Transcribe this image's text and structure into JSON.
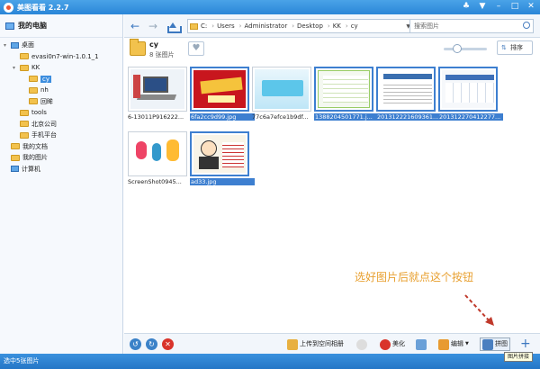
{
  "app": {
    "title": "美图看看 2.2.7"
  },
  "sidebar": {
    "root": "我的电脑",
    "nodes": [
      {
        "label": "桌面",
        "indent": 0,
        "type": "desktop",
        "expander": "▾"
      },
      {
        "label": "evasi0n7-win-1.0.1_1",
        "indent": 1,
        "type": "folder",
        "expander": ""
      },
      {
        "label": "KK",
        "indent": 1,
        "type": "folder",
        "expander": "▾"
      },
      {
        "label": "cy",
        "indent": 2,
        "type": "folder",
        "expander": "",
        "selected": true
      },
      {
        "label": "nh",
        "indent": 2,
        "type": "folder",
        "expander": ""
      },
      {
        "label": "回眸",
        "indent": 2,
        "type": "folder",
        "expander": ""
      },
      {
        "label": "tools",
        "indent": 1,
        "type": "folder",
        "expander": ""
      },
      {
        "label": "北京公司",
        "indent": 1,
        "type": "folder",
        "expander": ""
      },
      {
        "label": "手机平台",
        "indent": 1,
        "type": "folder",
        "expander": ""
      },
      {
        "label": "我的文档",
        "indent": 0,
        "type": "folder",
        "expander": ""
      },
      {
        "label": "我的图片",
        "indent": 0,
        "type": "folder",
        "expander": ""
      },
      {
        "label": "计算机",
        "indent": 0,
        "type": "desktop",
        "expander": ""
      }
    ]
  },
  "toolbar": {
    "back": "←",
    "forward": "→",
    "path": [
      "C:",
      "Users",
      "Administrator",
      "Desktop",
      "KK",
      "cy"
    ],
    "search_placeholder": "搜索图片"
  },
  "info": {
    "folder_name": "cy",
    "count": "8 张图片",
    "sort_label": "排序"
  },
  "thumbnails": [
    {
      "caption": "6-13011P916222...",
      "selected": false,
      "art": "laptop"
    },
    {
      "caption": "6fa2cc9d99.jpg",
      "selected": true,
      "art": "red"
    },
    {
      "caption": "77c6a7efce1b9df...",
      "selected": false,
      "art": "blue"
    },
    {
      "caption": "1388204501771.j...",
      "selected": true,
      "art": "table"
    },
    {
      "caption": "201312221609361...",
      "selected": true,
      "art": "doc"
    },
    {
      "caption": "201312270412277...",
      "selected": true,
      "art": "form"
    },
    {
      "caption": "ScreenShot0945...",
      "selected": false,
      "art": "cartoon"
    },
    {
      "caption": "ad33.jpg",
      "selected": true,
      "art": "person"
    }
  ],
  "bottombar": {
    "upload_label": "上传到空间相册",
    "beautify_label": "美化",
    "edit_label": "编辑",
    "puzzle_label": "拼图"
  },
  "statusbar": {
    "text": "选中5张图片"
  },
  "annotation": {
    "text": "选好图片后就点这个按钮"
  },
  "tooltip": {
    "text": "图片拼接"
  }
}
